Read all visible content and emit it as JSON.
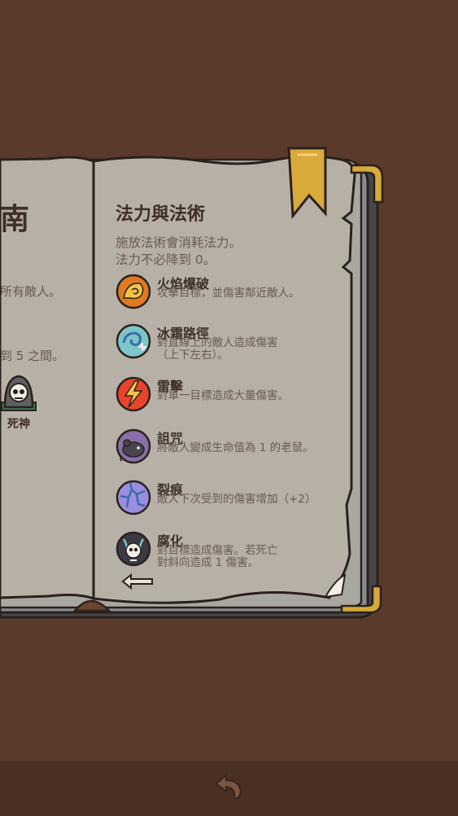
{
  "left_page": {
    "title_fragment": "南",
    "text_1": "所有敵人。",
    "text_2": "到 5 之間。",
    "monster_name": "死神"
  },
  "right_page": {
    "title": "法力與法術",
    "intro_line_1": "施放法術會消耗法力。",
    "intro_line_2": "法力不必降到 0。",
    "spells": [
      {
        "name": "火焰爆破",
        "desc_1": "攻擊目標，並傷害鄰近敵人。",
        "desc_2": "",
        "icon": "fire-blast-icon",
        "color": "#e07a1f"
      },
      {
        "name": "冰霜路徑",
        "desc_1": "對直線上的敵人造成傷害",
        "desc_2": "（上下左右）。",
        "icon": "frost-path-icon",
        "color": "#7cc6c9"
      },
      {
        "name": "雷擊",
        "desc_1": "對單一目標造成大量傷害。",
        "desc_2": "",
        "icon": "lightning-icon",
        "color": "#e8442b"
      },
      {
        "name": "詛咒",
        "desc_1": "將敵人變成生命值為 1 的老鼠。",
        "desc_2": "",
        "icon": "curse-icon",
        "color": "#8a6fa8"
      },
      {
        "name": "裂痕",
        "desc_1": "敵人下次受到的傷害增加（+2）",
        "desc_2": "",
        "icon": "crack-icon",
        "color": "#9b8ee0"
      },
      {
        "name": "腐化",
        "desc_1": "對目標造成傷害。若死亡",
        "desc_2": "對斜向造成 1 傷害。",
        "icon": "corruption-icon",
        "color": "#3b3a44"
      }
    ]
  },
  "colors": {
    "background": "#5a3a2b",
    "page": "#b6b0a7",
    "bookmark": "#d8a93b"
  }
}
